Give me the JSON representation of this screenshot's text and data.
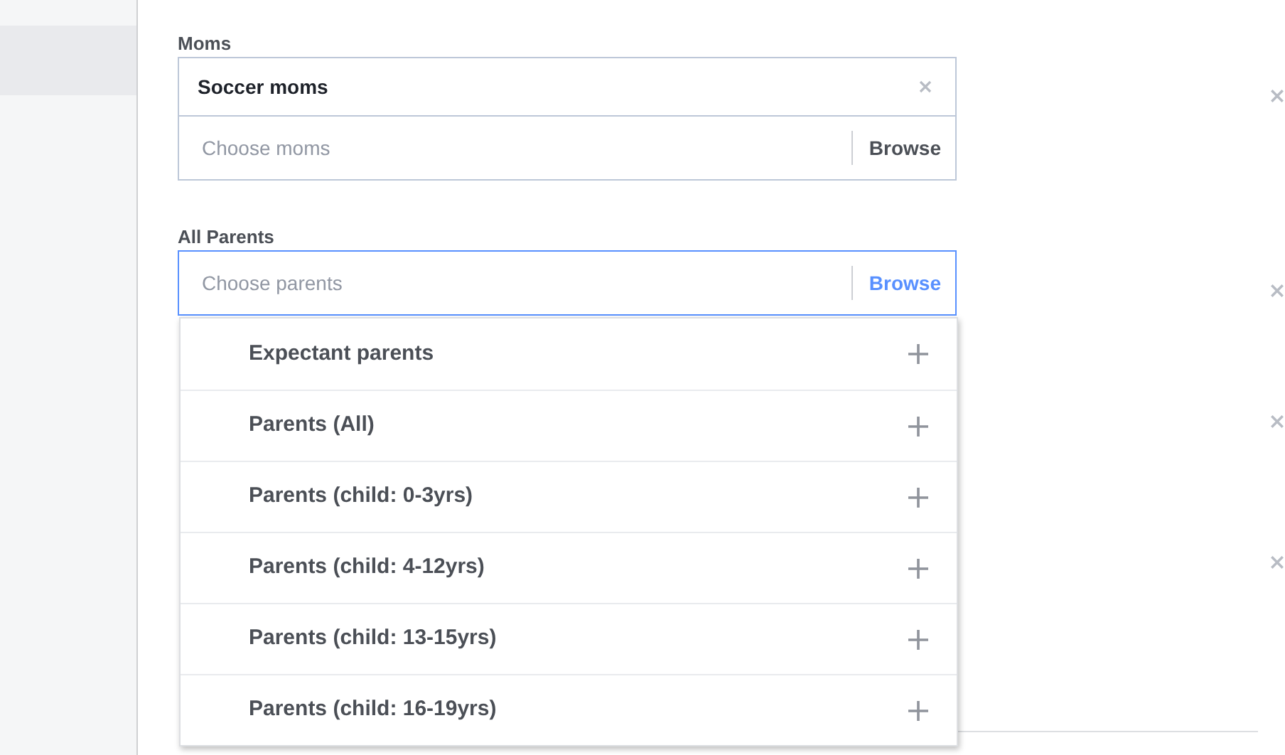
{
  "sections": [
    {
      "label": "Moms",
      "focused": false,
      "tokens": [
        {
          "text": "Soccer moms"
        }
      ],
      "placeholder": "Choose moms",
      "browse": "Browse"
    },
    {
      "label": "All Parents",
      "focused": true,
      "placeholder": "Choose parents",
      "browse": "Browse"
    }
  ],
  "dropdown": {
    "items": [
      {
        "text": "Expectant parents"
      },
      {
        "text": "Parents (All)"
      },
      {
        "text": "Parents (child: 0-3yrs)"
      },
      {
        "text": "Parents (child: 4-12yrs)"
      },
      {
        "text": "Parents (child: 13-15yrs)"
      },
      {
        "text": "Parents (child: 16-19yrs)"
      }
    ]
  }
}
